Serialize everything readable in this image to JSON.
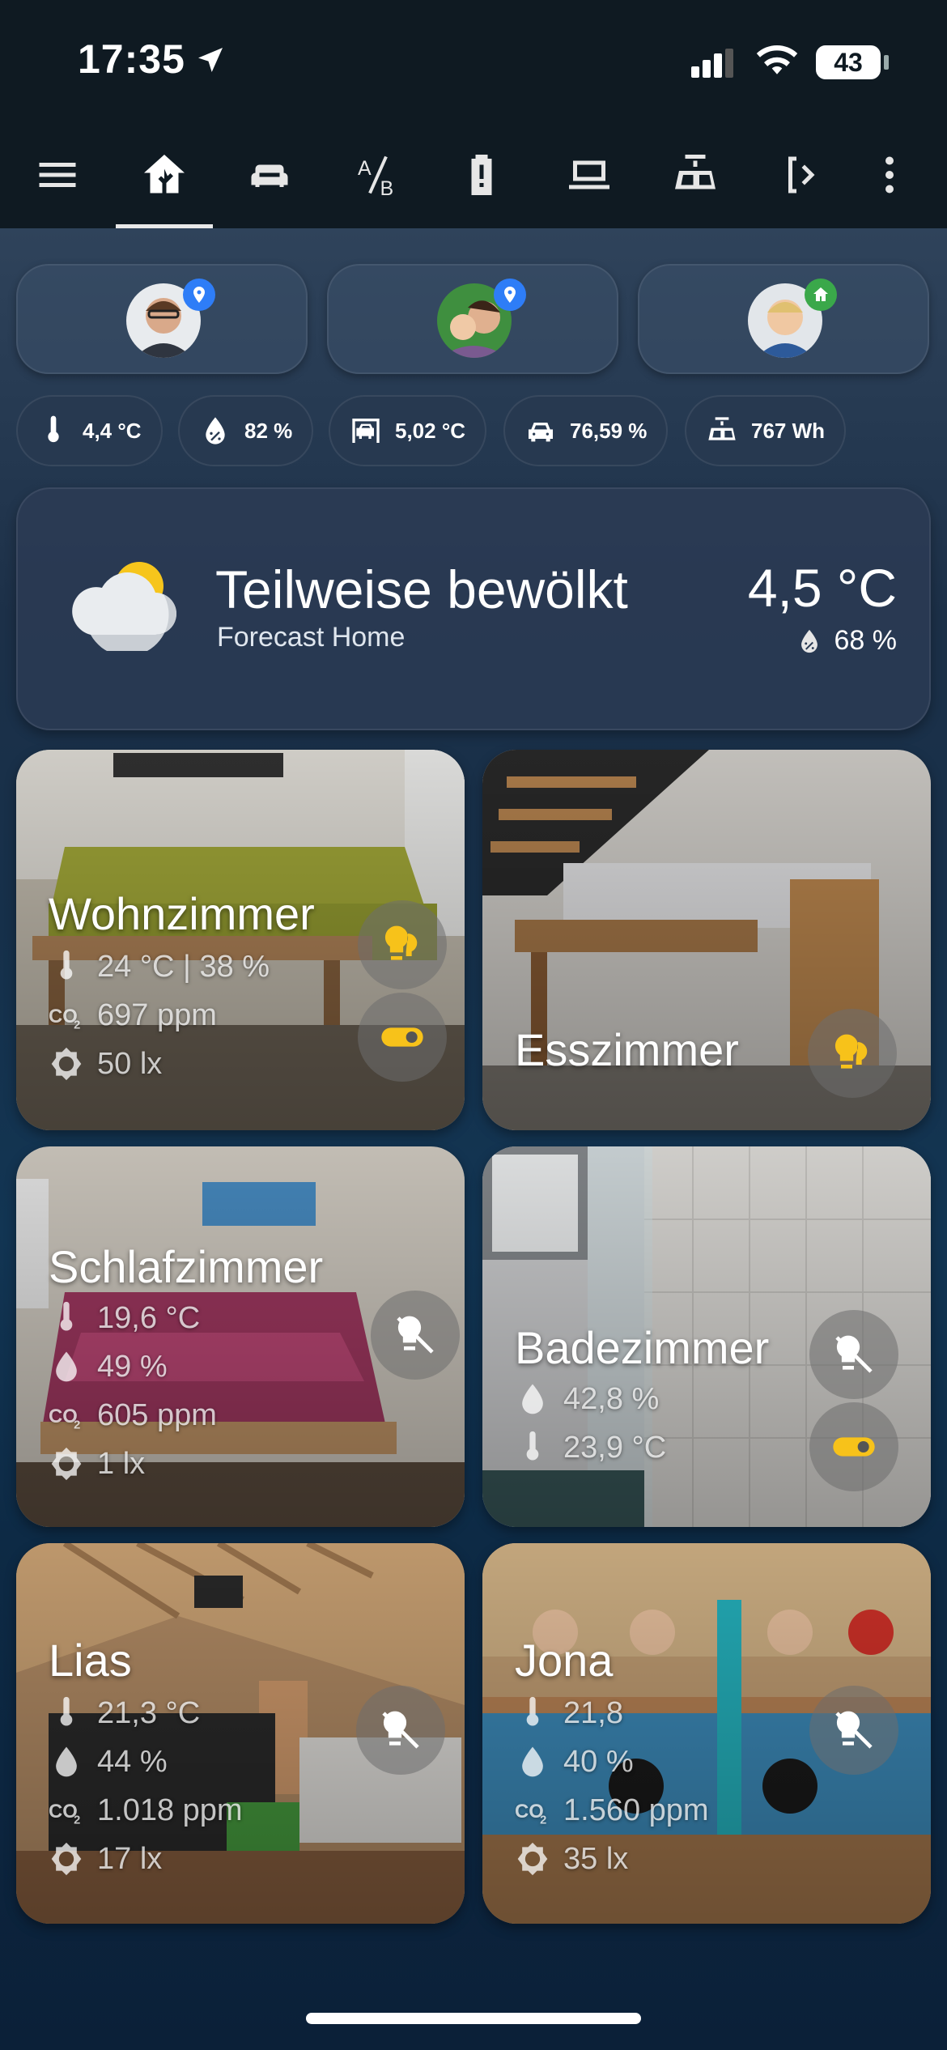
{
  "status_bar": {
    "time": "17:35",
    "battery": "43"
  },
  "tabs": [
    {
      "icon": "home-floorplan-icon",
      "active": true
    },
    {
      "icon": "sofa-icon",
      "active": false
    },
    {
      "icon": "ab-testing-icon",
      "active": false
    },
    {
      "icon": "battery-alert-icon",
      "active": false
    },
    {
      "icon": "laptop-icon",
      "active": false
    },
    {
      "icon": "solar-panel-icon",
      "active": false
    },
    {
      "icon": "code-bracket-icon",
      "active": false
    }
  ],
  "persons": [
    {
      "name": "person-1",
      "badge": "map-marker-icon",
      "badge_color": "#2e7df7"
    },
    {
      "name": "person-2",
      "badge": "map-marker-icon",
      "badge_color": "#2e7df7"
    },
    {
      "name": "person-3",
      "badge": "home-icon",
      "badge_color": "#3aa84a"
    }
  ],
  "chips": [
    {
      "icon": "thermometer-icon",
      "value": "4,4 °C"
    },
    {
      "icon": "water-percent-icon",
      "value": "82 %"
    },
    {
      "icon": "garage-car-icon",
      "value": "5,02 °C"
    },
    {
      "icon": "car-icon",
      "value": "76,59 %"
    },
    {
      "icon": "solar-panel-icon",
      "value": "767 Wh"
    }
  ],
  "weather": {
    "condition": "Teilweise bewölkt",
    "source": "Forecast Home",
    "temperature": "4,5 °C",
    "humidity": "68 %"
  },
  "rooms": {
    "wohnzimmer": {
      "name": "Wohnzimmer",
      "temp_hum": "24 °C | 38 %",
      "co2": "697 ppm",
      "lux": "50 lx"
    },
    "esszimmer": {
      "name": "Esszimmer"
    },
    "schlafzimmer": {
      "name": "Schlafzimmer",
      "temp": "19,6 °C",
      "hum": "49 %",
      "co2": "605 ppm",
      "lux": "1 lx"
    },
    "badezimmer": {
      "name": "Badezimmer",
      "hum": "42,8 %",
      "temp": "23,9 °C"
    },
    "lias": {
      "name": "Lias",
      "temp": "21,3 °C",
      "hum": "44 %",
      "co2": "1.018 ppm",
      "lux": "17 lx"
    },
    "jona": {
      "name": "Jona",
      "temp": "21,8",
      "hum": "40 %",
      "co2": "1.560 ppm",
      "lux": "35 lx"
    }
  },
  "colors": {
    "accent_yellow": "#f7c21a",
    "bar_bg": "#0f1a22"
  }
}
